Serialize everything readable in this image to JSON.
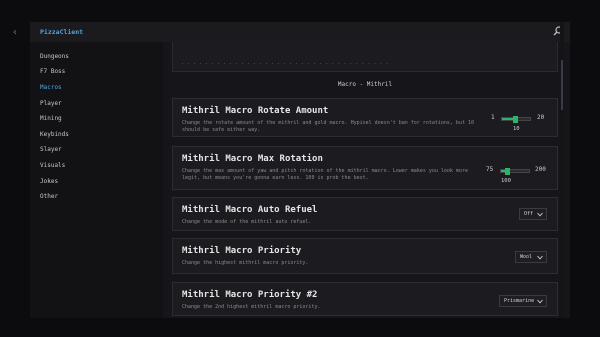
{
  "app": {
    "title": "PizzaClient"
  },
  "sidebar": {
    "items": [
      {
        "label": "Dungeons"
      },
      {
        "label": "F7 Boss"
      },
      {
        "label": "Macros",
        "active": true
      },
      {
        "label": "Player"
      },
      {
        "label": "Mining"
      },
      {
        "label": "Keybinds"
      },
      {
        "label": "Slayer"
      },
      {
        "label": "Visuals"
      },
      {
        "label": "Jokes"
      },
      {
        "label": "Other"
      }
    ]
  },
  "content": {
    "clipped_text": "· · · · · · · · · · · · · · · · · · · · · · · · · · · · · · · · · · ·",
    "section_header": "Macro - Mithril",
    "cards": [
      {
        "title": "Mithril Macro Rotate Amount",
        "description": "Change the rotate amount of the mithril and gold macro. Hypixel doesn't ban for rotations, but 10 should be safe either way.",
        "control": {
          "type": "slider",
          "min": "1",
          "max": "20",
          "value": "10",
          "fraction": 0.47
        }
      },
      {
        "title": "Mithril Macro Max Rotation",
        "description": "Change the max amount of yaw and pitch rotation of the mithril macro. Lower makes you look more legit, but means you're gonna earn less. 100 is prob the best.",
        "control": {
          "type": "slider",
          "min": "75",
          "max": "200",
          "value": "100",
          "fraction": 0.2
        }
      },
      {
        "title": "Mithril Macro Auto Refuel",
        "description": "Change the mode of the mithril auto refuel.",
        "control": {
          "type": "select",
          "value": "Off"
        }
      },
      {
        "title": "Mithril Macro Priority",
        "description": "Change the highest mithril macro priority.",
        "control": {
          "type": "select",
          "value": "Wool"
        }
      },
      {
        "title": "Mithril Macro Priority #2",
        "description": "Change the 2nd highest mithril macro priority.",
        "control": {
          "type": "select",
          "value": "Prismarine"
        }
      }
    ]
  },
  "colors": {
    "accent": "#4fa8e0",
    "slider": "#2fb36b",
    "background": "#16161a",
    "card": "#1b1b20"
  },
  "icons": {
    "back": "chevron-left-icon",
    "search": "search-icon",
    "dropdown": "chevron-down-icon"
  }
}
